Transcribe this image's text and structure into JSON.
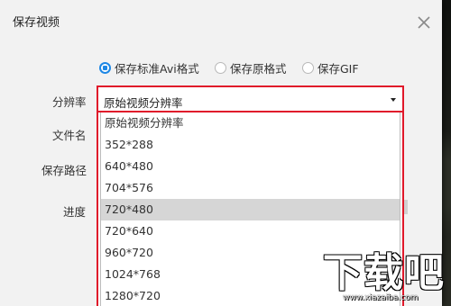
{
  "dialog": {
    "title": "保存视频"
  },
  "format_options": [
    {
      "label": "保存标准Avi格式",
      "checked": true
    },
    {
      "label": "保存原格式",
      "checked": false
    },
    {
      "label": "保存GIF",
      "checked": false
    }
  ],
  "fields": {
    "resolution_label": "分辨率",
    "filename_label": "文件名",
    "save_path_label": "保存路径",
    "progress_label": "进度"
  },
  "resolution": {
    "selected": "原始视频分辨率",
    "options": [
      "原始视频分辨率",
      "352*288",
      "640*480",
      "704*576",
      "720*480",
      "720*640",
      "960*720",
      "1024*768",
      "1280*720"
    ],
    "hovered_index": 4
  },
  "watermark": {
    "text": "下载吧",
    "url": "www.xiazaiba.com"
  },
  "colors": {
    "accent": "#1e88e5",
    "highlight_border": "#e0182a",
    "hover_bg": "#d6d6d6"
  }
}
